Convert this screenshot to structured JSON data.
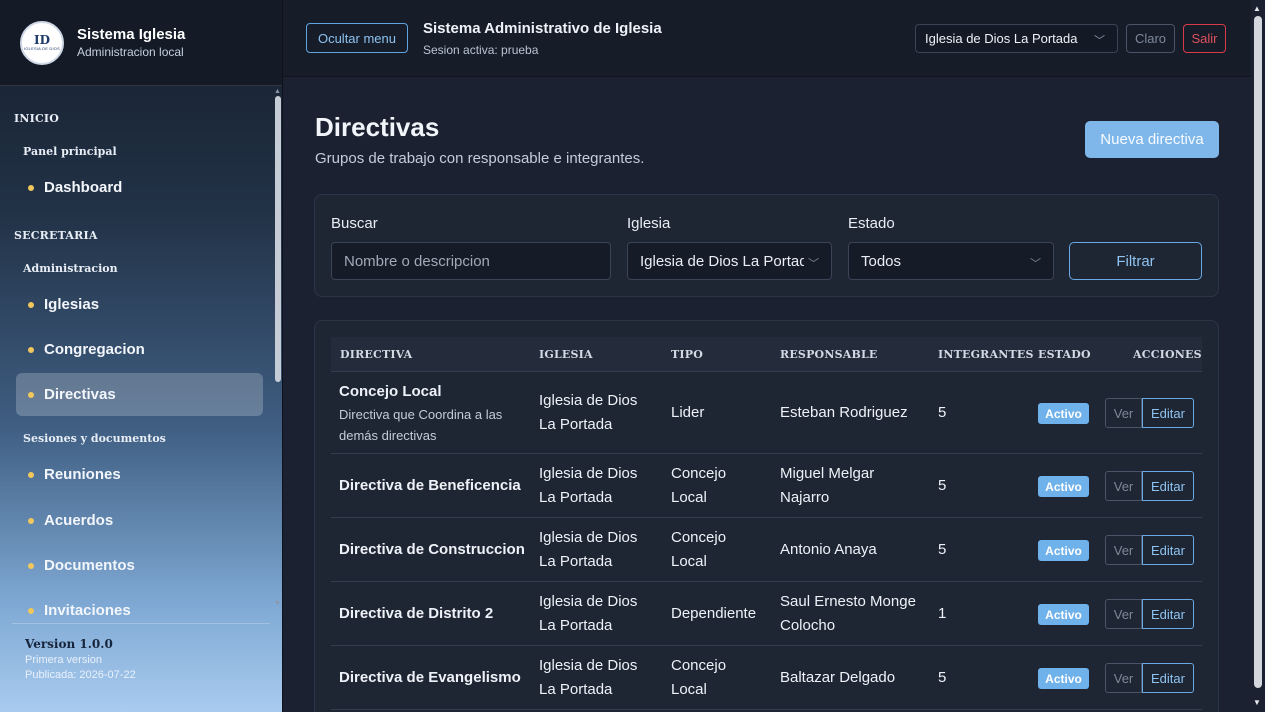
{
  "sidebar": {
    "logo": {
      "text": "ID",
      "sub": "IGLESIA DE DIOS"
    },
    "title": "Sistema Iglesia",
    "subtitle": "Administracion local",
    "sections": {
      "inicio": "INICIO",
      "panel": "Panel principal",
      "dashboard": "Dashboard",
      "secretaria": "SECRETARIA",
      "administracion": "Administracion",
      "iglesias": "Iglesias",
      "congregacion": "Congregacion",
      "directivas": "Directivas",
      "sesiones": "Sesiones y documentos",
      "reuniones": "Reuniones",
      "acuerdos": "Acuerdos",
      "documentos": "Documentos",
      "invitaciones": "Invitaciones"
    },
    "footer": {
      "version": "Version 1.0.0",
      "note": "Primera version",
      "published": "Publicada: 2026-07-22"
    }
  },
  "header": {
    "toggle_label": "Ocultar menu",
    "title": "Sistema Administrativo de Iglesia",
    "session": "Sesion activa: prueba",
    "church_select": "Iglesia de Dios La Portada",
    "theme_label": "Claro",
    "logout_label": "Salir"
  },
  "page": {
    "title": "Directivas",
    "subtitle": "Grupos de trabajo con responsable e integrantes.",
    "new_label": "Nueva directiva"
  },
  "filters": {
    "search_label": "Buscar",
    "search_placeholder": "Nombre o descripcion",
    "church_label": "Iglesia",
    "church_value": "Iglesia de Dios La Portada",
    "status_label": "Estado",
    "status_value": "Todos",
    "filter_label": "Filtrar"
  },
  "table": {
    "headers": [
      "DIRECTIVA",
      "IGLESIA",
      "TIPO",
      "RESPONSABLE",
      "INTEGRANTES",
      "ESTADO",
      "ACCIONES"
    ],
    "view_label": "Ver",
    "edit_label": "Editar",
    "rows": [
      {
        "name": "Concejo Local",
        "desc1": "Directiva que Coordina a las",
        "desc2": "demás directivas",
        "church1": "Iglesia de Dios",
        "church2": "La Portada",
        "type1": "Lider",
        "type2": "",
        "resp1": "Esteban Rodriguez",
        "resp2": "",
        "members": "5",
        "status": "Activo"
      },
      {
        "name": "Directiva de Beneficencia",
        "desc1": "",
        "desc2": "",
        "church1": "Iglesia de Dios",
        "church2": "La Portada",
        "type1": "Concejo",
        "type2": "Local",
        "resp1": "Miguel Melgar",
        "resp2": "Najarro",
        "members": "5",
        "status": "Activo"
      },
      {
        "name": "Directiva de Construccion",
        "desc1": "",
        "desc2": "",
        "church1": "Iglesia de Dios",
        "church2": "La Portada",
        "type1": "Concejo",
        "type2": "Local",
        "resp1": "Antonio Anaya",
        "resp2": "",
        "members": "5",
        "status": "Activo"
      },
      {
        "name": "Directiva de Distrito 2",
        "desc1": "",
        "desc2": "",
        "church1": "Iglesia de Dios",
        "church2": "La Portada",
        "type1": "Dependiente",
        "type2": "",
        "resp1": "Saul Ernesto Monge",
        "resp2": "Colocho",
        "members": "1",
        "status": "Activo"
      },
      {
        "name": "Directiva de Evangelismo",
        "desc1": "",
        "desc2": "",
        "church1": "Iglesia de Dios",
        "church2": "La Portada",
        "type1": "Concejo",
        "type2": "Local",
        "resp1": "Baltazar Delgado",
        "resp2": "",
        "members": "5",
        "status": "Activo"
      }
    ]
  }
}
